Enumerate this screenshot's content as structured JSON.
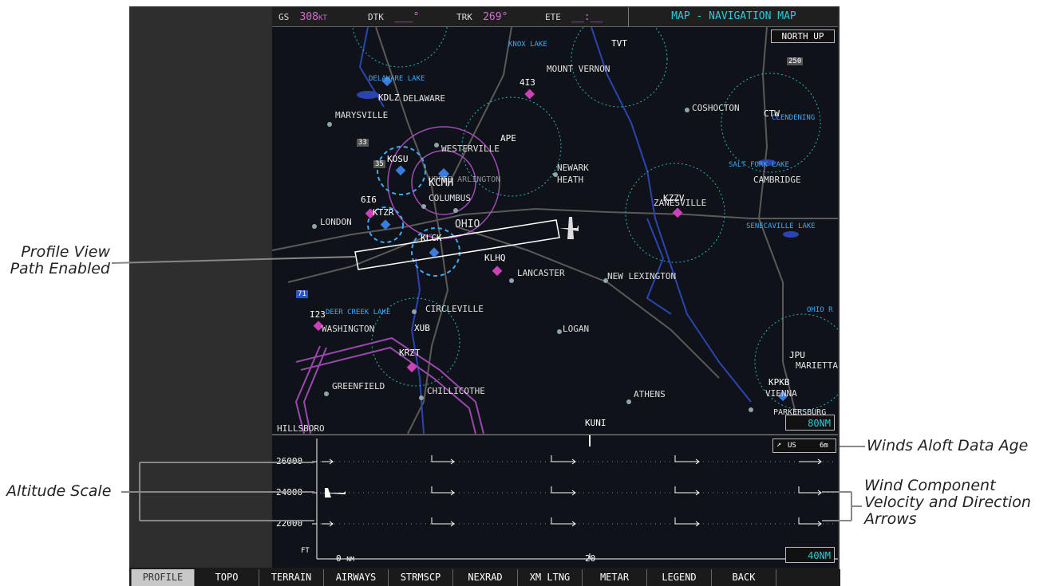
{
  "topbar": {
    "gs_label": "GS",
    "gs_value": "308",
    "gs_unit": "KT",
    "dtk_label": "DTK",
    "dtk_value": "___°",
    "trk_label": "TRK",
    "trk_value": "269°",
    "ete_label": "ETE",
    "ete_value": "__:__",
    "title": "MAP - NAVIGATION MAP"
  },
  "map": {
    "orientation": "NORTH UP",
    "range": "80NM",
    "airports": [
      "KDLZ",
      "KOSU",
      "KCMH",
      "KTZR",
      "KLCK",
      "KLHQ",
      "KZZV",
      "KRZT",
      "KPKB",
      "I23",
      "4I3",
      "6I6",
      "KUNI"
    ],
    "vors": [
      "APE",
      "XUB",
      "CTW",
      "TVT",
      "JPU"
    ],
    "cities": [
      "MOUNT VERNON",
      "DELAWARE",
      "MARYSVILLE",
      "WESTERVILLE",
      "NEWARK",
      "HEATH",
      "COSHOCTON",
      "CAMBRIDGE",
      "UPPER ARLINGTON",
      "COLUMBUS",
      "OHIO",
      "LONDON",
      "ZANESVILLE",
      "LANCASTER",
      "NEW LEXINGTON",
      "CIRCLEVILLE",
      "WASHINGTON",
      "LOGAN",
      "GREENFIELD",
      "CHILLICOTHE",
      "ATHENS",
      "MARIETTA",
      "VIENNA",
      "HILLSBORO",
      "PARKERSBURG"
    ],
    "water": [
      "KNOX LAKE",
      "DELAWARE LAKE",
      "SALT FORK LAKE",
      "SENECAVILLE LAKE",
      "DEER CREEK LAKE",
      "CLENDENING",
      "OHIO R"
    ],
    "highways": [
      "71",
      "250",
      "33",
      "35"
    ]
  },
  "profile": {
    "altitudes": [
      "26000",
      "24000",
      "22000"
    ],
    "unit": "FT",
    "dist_start": "0",
    "dist_unit": "NM",
    "dist_mark": "20",
    "range": "40NM",
    "winds_source": "US",
    "winds_age": "6m"
  },
  "softkeys": [
    "PROFILE",
    "TOPO",
    "TERRAIN",
    "AIRWAYS",
    "STRMSCP",
    "NEXRAD",
    "XM LTNG",
    "METAR",
    "LEGEND",
    "BACK",
    ""
  ],
  "callouts": {
    "profile_path_line1": "Profile View",
    "profile_path_line2": "Path Enabled",
    "winds_age": "Winds Aloft Data Age",
    "altitude_scale": "Altitude Scale",
    "wind_line1": "Wind Component",
    "wind_line2": "Velocity and Direction",
    "wind_line3": "Arrows"
  },
  "colors": {
    "accent_cyan": "#36c7d8",
    "magenta": "#cf6fd0",
    "water_blue": "#3fa9f5"
  }
}
